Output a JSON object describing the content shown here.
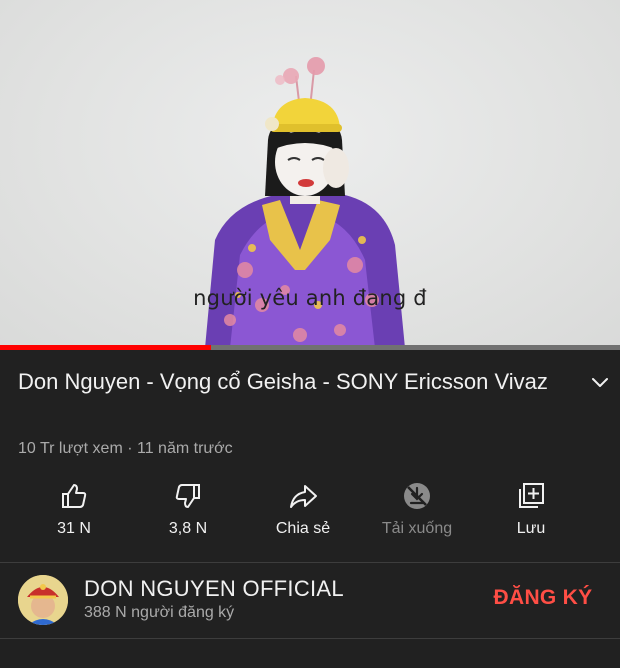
{
  "player": {
    "subtitle": "người yêu anh đang đ",
    "progress_fraction": 0.34,
    "progress_color": "#ff0000"
  },
  "video": {
    "title": "Don Nguyen - Vọng cổ Geisha - SONY Ericsson Vivaz",
    "meta": "10 Tr lượt xem · 11 năm trước"
  },
  "actions": {
    "like": {
      "label": "31 N",
      "icon": "thumbs-up-icon"
    },
    "dislike": {
      "label": "3,8 N",
      "icon": "thumbs-down-icon"
    },
    "share": {
      "label": "Chia sẻ",
      "icon": "share-icon"
    },
    "download": {
      "label": "Tải xuống",
      "icon": "download-disabled-icon"
    },
    "save": {
      "label": "Lưu",
      "icon": "playlist-add-icon"
    }
  },
  "channel": {
    "name": "DON NGUYEN OFFICIAL",
    "subscribers": "388 N người đăng ký",
    "subscribe_label": "ĐĂNG KÝ",
    "subscribe_color": "#ff4e45"
  }
}
